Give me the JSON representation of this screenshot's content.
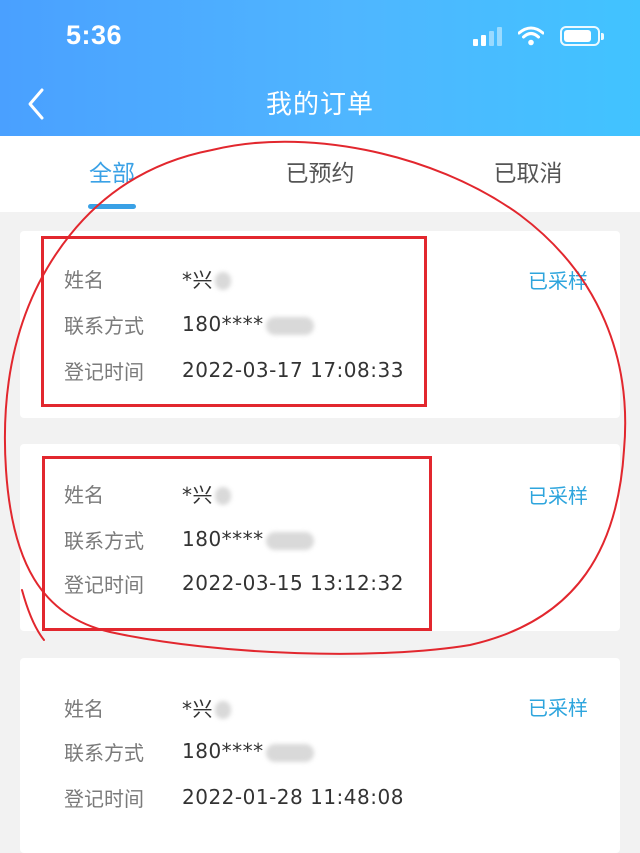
{
  "status_bar": {
    "time": "5:36"
  },
  "header": {
    "title": "我的订单"
  },
  "tabs": [
    {
      "label": "全部",
      "active": true
    },
    {
      "label": "已预约",
      "active": false
    },
    {
      "label": "已取消",
      "active": false
    }
  ],
  "orders": [
    {
      "name_label": "姓名",
      "name": "*兴",
      "contact_label": "联系方式",
      "phone": "180****",
      "time_label": "登记时间",
      "time": "2022-03-17 17:08:33",
      "status": "已采样"
    },
    {
      "name_label": "姓名",
      "name": "*兴",
      "contact_label": "联系方式",
      "phone": "180****",
      "time_label": "登记时间",
      "time": "2022-03-15 13:12:32",
      "status": "已采样"
    },
    {
      "name_label": "姓名",
      "name": "*兴",
      "contact_label": "联系方式",
      "phone": "180****",
      "time_label": "登记时间",
      "time": "2022-01-28 11:48:08",
      "status": "已采样"
    }
  ],
  "colors": {
    "header_start": "#4aa0ff",
    "header_end": "#41c3ff",
    "accent": "#3aa1e6",
    "annotation": "#e2272e"
  },
  "icons": {
    "back": "chevron-left-icon",
    "signal": "cellular-signal-icon",
    "wifi": "wifi-icon",
    "battery": "battery-icon"
  }
}
